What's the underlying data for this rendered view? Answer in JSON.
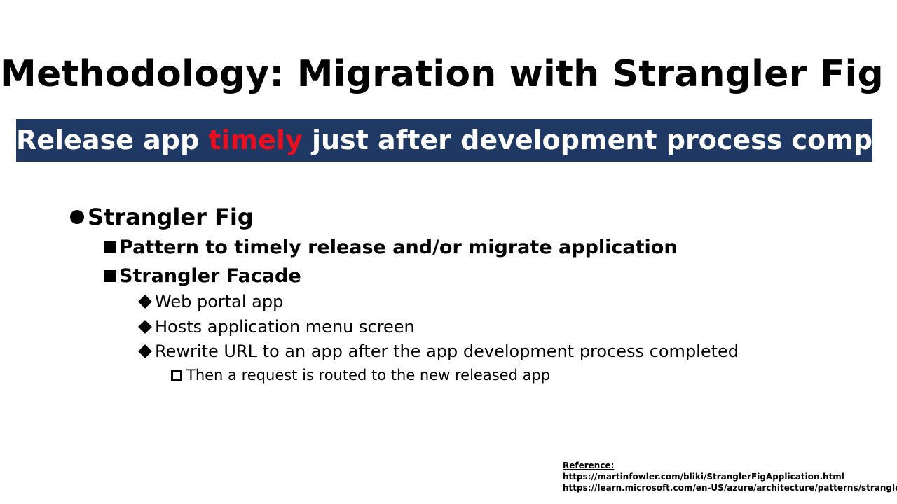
{
  "slide": {
    "title": "Methodology: Migration with Strangler Fig",
    "banner": {
      "before": "Release app ",
      "highlight": "timely",
      "after": " just after development process completed",
      "background_color": "#1f3864",
      "highlight_color": "#e8101e"
    },
    "bullets": {
      "level1": {
        "text": "Strangler Fig",
        "marker_icon": "filled-circle-bullet"
      },
      "level2": [
        {
          "text": "Pattern to timely release and/or migrate application",
          "marker_icon": "filled-square-bullet"
        },
        {
          "text": "Strangler Facade",
          "marker_icon": "filled-square-bullet"
        }
      ],
      "level3": [
        {
          "text": "Web portal app",
          "marker_icon": "filled-diamond-bullet"
        },
        {
          "text": "Hosts application menu screen",
          "marker_icon": "filled-diamond-bullet"
        },
        {
          "text": "Rewrite URL to an app after the app development process completed",
          "marker_icon": "filled-diamond-bullet"
        }
      ],
      "level4": [
        {
          "text": "Then a request is routed to the new released app",
          "marker_icon": "hollow-square-bullet"
        }
      ]
    },
    "reference": {
      "heading": "Reference:",
      "links": [
        "https://martinfowler.com/bliki/StranglerFigApplication.html",
        "https://learn.microsoft.com/en-US/azure/architecture/patterns/strangler-fig"
      ]
    }
  }
}
